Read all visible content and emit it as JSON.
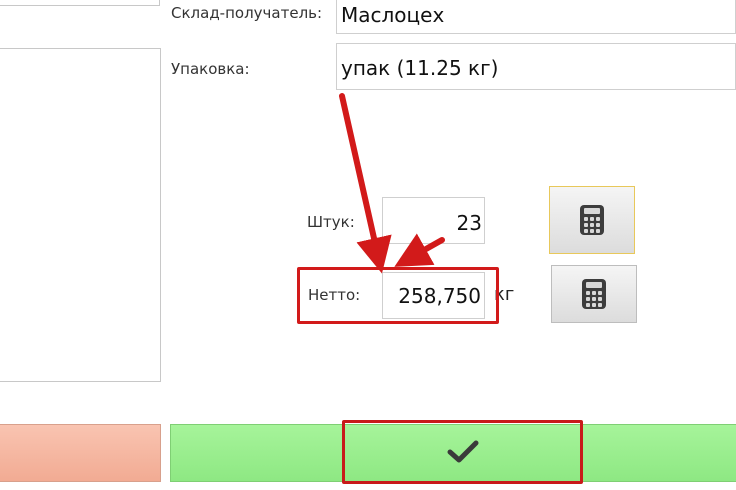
{
  "form": {
    "warehouse_label": "Склад-получатель:",
    "warehouse_value": "Маслоцех",
    "package_label": "Упаковка:",
    "package_value": "упак (11.25 кг)",
    "pieces_label": "Штук:",
    "pieces_value": "23",
    "net_label": "Нетто:",
    "net_value": "258,750",
    "net_unit": "кг"
  },
  "icons": {
    "calculator": "calculator-icon",
    "confirm": "checkmark-icon"
  },
  "colors": {
    "confirm_button": "#98ee8c",
    "cancel_button": "#f5b8a2",
    "annotation": "#d21a1a",
    "focused_border": "#e8c85a"
  }
}
